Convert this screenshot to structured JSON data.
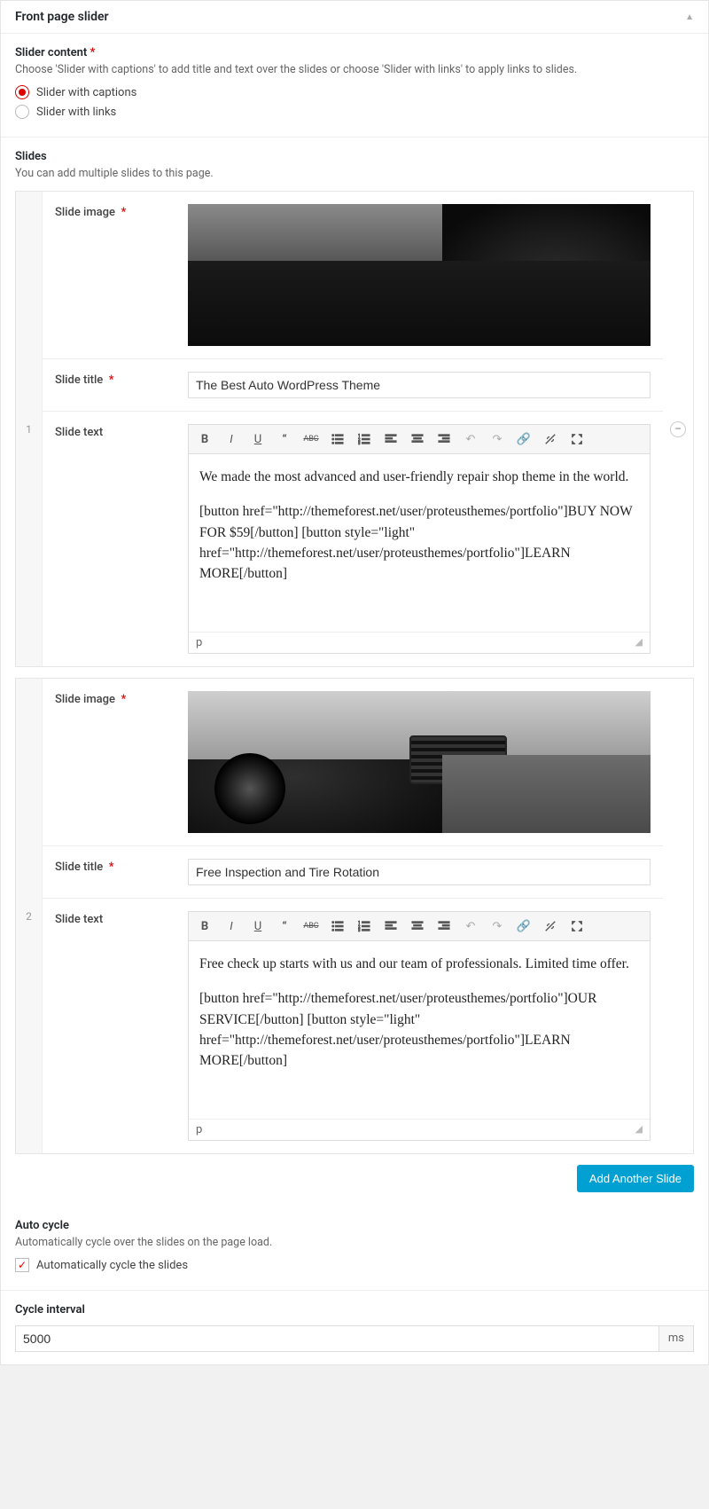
{
  "panel": {
    "title": "Front page slider"
  },
  "slider_content": {
    "title": "Slider content",
    "desc": "Choose 'Slider with captions' to add title and text over the slides or choose 'Slider with links' to apply links to slides.",
    "options": {
      "captions": "Slider with captions",
      "links": "Slider with links"
    }
  },
  "slides_section": {
    "title": "Slides",
    "desc": "You can add multiple slides to this page."
  },
  "field_labels": {
    "image": "Slide image",
    "title": "Slide title",
    "text": "Slide text"
  },
  "slides": [
    {
      "index": "1",
      "title": "The Best Auto WordPress Theme",
      "text_p1": "We made the most advanced and user-friendly repair shop theme in the world.",
      "text_p2": "[button  href=\"http://themeforest.net/user/proteusthemes/portfolio\"]BUY NOW FOR $59[/button] [button style=\"light\" href=\"http://themeforest.net/user/proteusthemes/portfolio\"]LEARN MORE[/button]",
      "status": "p"
    },
    {
      "index": "2",
      "title": "Free Inspection and Tire Rotation",
      "text_p1": "Free check up starts with us and our team of professionals. Limited time offer.",
      "text_p2": "[button  href=\"http://themeforest.net/user/proteusthemes/portfolio\"]OUR SERVICE[/button] [button style=\"light\" href=\"http://themeforest.net/user/proteusthemes/portfolio\"]LEARN MORE[/button]",
      "status": "p"
    }
  ],
  "add_button": "Add Another Slide",
  "auto_cycle": {
    "title": "Auto cycle",
    "desc": "Automatically cycle over the slides on the page load.",
    "label": "Automatically cycle the slides"
  },
  "cycle_interval": {
    "title": "Cycle interval",
    "value": "5000",
    "suffix": "ms"
  },
  "toolbar_icons": [
    "bold",
    "italic",
    "underline",
    "quote",
    "strike",
    "ul",
    "ol",
    "align-left",
    "align-center",
    "align-right",
    "undo",
    "redo",
    "link",
    "unlink",
    "fullscreen"
  ]
}
